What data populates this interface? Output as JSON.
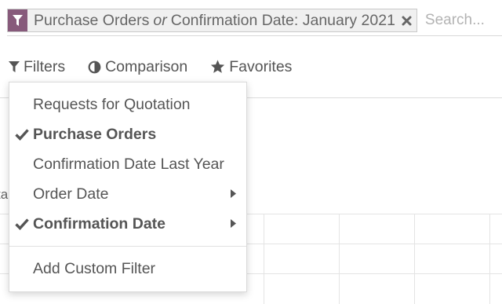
{
  "search": {
    "facet_part1": "Purchase Orders",
    "facet_or": "or",
    "facet_part2": "Confirmation Date: January 2021",
    "placeholder": "Search..."
  },
  "toolbar": {
    "filters_label": "Filters",
    "comparison_label": "Comparison",
    "favorites_label": "Favorites"
  },
  "background": {
    "cut_label": "ta"
  },
  "filters_menu": {
    "items": [
      {
        "label": "Requests for Quotation",
        "selected": false,
        "has_submenu": false
      },
      {
        "label": "Purchase Orders",
        "selected": true,
        "has_submenu": false
      },
      {
        "label": "Confirmation Date Last Year",
        "selected": false,
        "has_submenu": false
      },
      {
        "label": "Order Date",
        "selected": false,
        "has_submenu": true
      },
      {
        "label": "Confirmation Date",
        "selected": true,
        "has_submenu": true
      }
    ],
    "add_custom_label": "Add Custom Filter"
  },
  "colors": {
    "facet_accent": "#875a7b",
    "text": "#555555"
  }
}
